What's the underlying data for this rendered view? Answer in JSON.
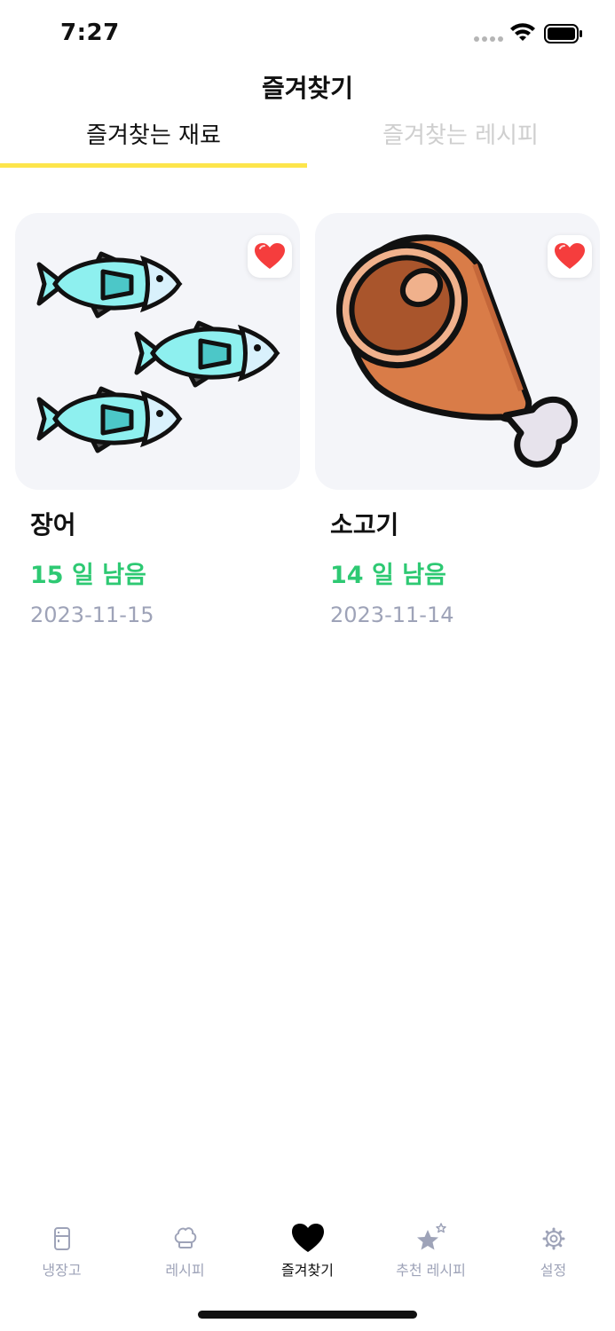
{
  "status_bar": {
    "time": "7:27"
  },
  "header": {
    "title": "즐겨찾기"
  },
  "tabs": [
    {
      "label": "즐겨찾는 재료",
      "selected": true
    },
    {
      "label": "즐겨찾는 레시피",
      "selected": false
    }
  ],
  "colors": {
    "accent": "#fde54b",
    "remaining": "#2ec973",
    "date": "#9ea3b8",
    "heart": "#f53d3d"
  },
  "items": [
    {
      "name": "장어",
      "remaining": "15 일 남음",
      "date": "2023-11-15",
      "icon": "fish-icon",
      "favorited": true
    },
    {
      "name": "소고기",
      "remaining": "14 일 남음",
      "date": "2023-11-14",
      "icon": "meat-leg-icon",
      "favorited": true
    }
  ],
  "bottom_nav": {
    "items": [
      {
        "label": "냉장고",
        "icon": "fridge-icon",
        "active": false
      },
      {
        "label": "레시피",
        "icon": "chef-hat-icon",
        "active": false
      },
      {
        "label": "즐겨찾기",
        "icon": "heart-icon",
        "active": true
      },
      {
        "label": "추천 레시피",
        "icon": "star-icon",
        "active": false
      },
      {
        "label": "설정",
        "icon": "gear-icon",
        "active": false
      }
    ]
  }
}
